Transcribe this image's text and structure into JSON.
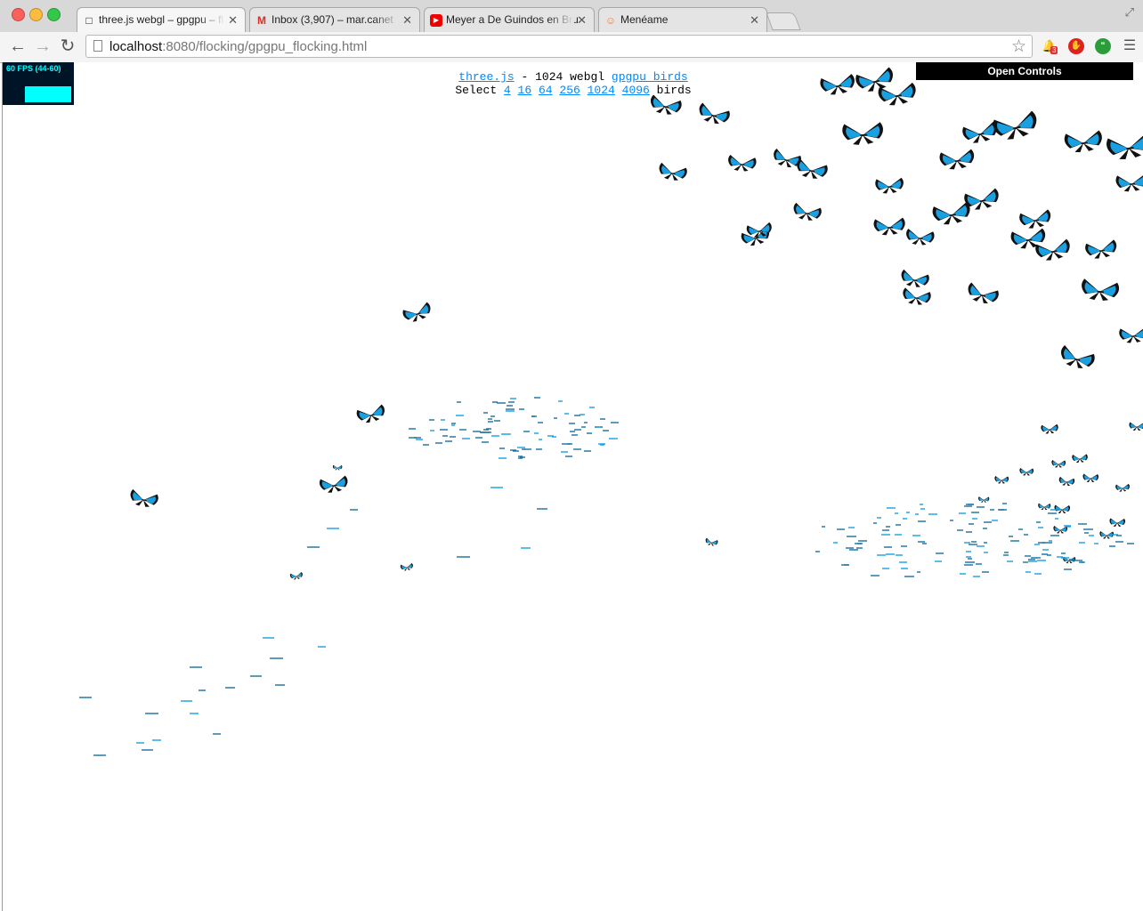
{
  "tabs": [
    {
      "title": "three.js webgl – gpgpu – fl",
      "icon": "page-icon",
      "active": true
    },
    {
      "title": "Inbox (3,907) – mar.canet",
      "icon": "gmail-icon",
      "active": false
    },
    {
      "title": "Meyer a De Guindos en Bru",
      "icon": "youtube-icon",
      "active": false
    },
    {
      "title": "Menéame",
      "icon": "meneame-icon",
      "active": false
    }
  ],
  "address": {
    "host": "localhost",
    "path": ":8080/flocking/gpgpu_flocking.html"
  },
  "extensions": {
    "notification_badge": "3"
  },
  "stats": {
    "fps_text": "60 FPS (44-60)"
  },
  "info": {
    "link_threejs": "three.js",
    "text_middle": " - 1024 webgl ",
    "link_demo": "gpgpu birds",
    "select_prefix": "Select ",
    "counts": [
      "4",
      "16",
      "64",
      "256",
      "1024",
      "4096"
    ],
    "select_suffix": " birds"
  },
  "controls": {
    "label": "Open Controls"
  },
  "colors": {
    "bird_blue": "#1a9fe0",
    "bird_black": "#111111",
    "stats_bg": "#001428",
    "stats_fg": "#00ffff",
    "link": "#0088ff"
  }
}
